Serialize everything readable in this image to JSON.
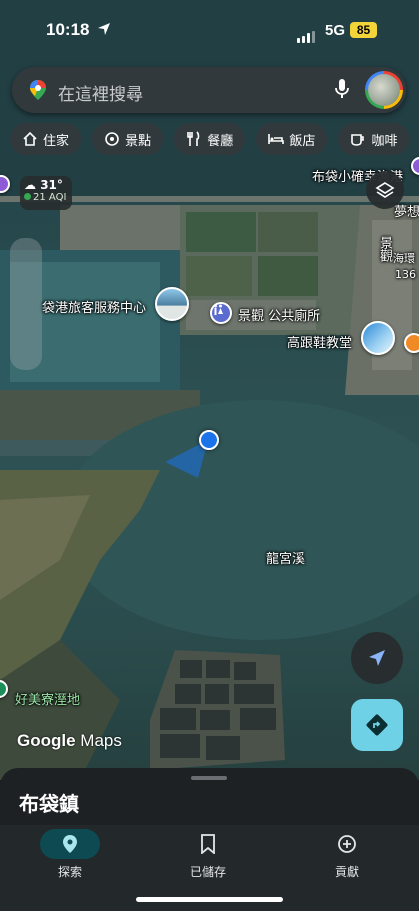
{
  "status": {
    "time": "10:18",
    "network": "5G",
    "battery": "85"
  },
  "search": {
    "placeholder": "在這裡搜尋"
  },
  "chips": [
    {
      "label": "住家",
      "icon": "home-icon"
    },
    {
      "label": "景點",
      "icon": "attraction-icon"
    },
    {
      "label": "餐廳",
      "icon": "restaurant-icon"
    },
    {
      "label": "飯店",
      "icon": "hotel-icon"
    },
    {
      "label": "咖啡",
      "icon": "coffee-icon"
    }
  ],
  "weather": {
    "temp": "31°",
    "aqi": "21 AQI"
  },
  "map_labels": {
    "top_right": "布袋小確幸",
    "top_right_2": "漁港",
    "cut_right": "夢想",
    "road_1": "海環",
    "road_2": "136",
    "vertical": "景觀",
    "visitor_center": "袋港旅客服務中心",
    "restroom": "景觀 公共廁所",
    "church": "高跟鞋教堂",
    "creek": "龍宮溪",
    "wetland": "好美寮溼地"
  },
  "attribution": {
    "google": "Google",
    "maps": "Maps"
  },
  "sheet": {
    "title": "布袋鎮"
  },
  "nav": {
    "explore": "探索",
    "saved": "已儲存",
    "contribute": "貢獻"
  },
  "colors": {
    "accent": "#6fd1e6",
    "nav_active": "#0d4a52",
    "location_dot": "#1a73e8",
    "battery": "#f3d539"
  }
}
